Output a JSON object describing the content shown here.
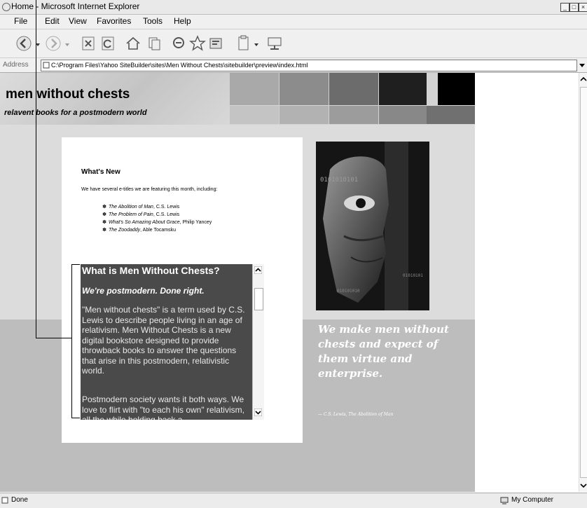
{
  "window": {
    "title": "Home - Microsoft Internet Explorer"
  },
  "menu": {
    "items": [
      "File",
      "Edit",
      "View",
      "Favorites",
      "Tools",
      "Help"
    ]
  },
  "toolbar": {
    "buttons": [
      "back-icon",
      "forward-icon",
      "stop-icon",
      "refresh-icon",
      "home-icon",
      "pages-icon",
      "search-icon",
      "favorites-icon",
      "media-icon",
      "mail-icon",
      "network-icon"
    ]
  },
  "address": {
    "label": "Address",
    "url": "C:\\Program Files\\Yahoo SiteBuilder\\sites\\Men Without Chests\\sitebuilder\\preview\\index.html"
  },
  "site": {
    "title": "men without chests",
    "subtitle": "relavent books for a postmodern world",
    "whats_new": {
      "heading": "What's New",
      "intro": "We have several e-titles we are featuring this month, including:",
      "books": [
        {
          "title": "The Abolition of Man",
          "author": ", C.S. Lewis"
        },
        {
          "title": "The Problem of Pain",
          "author": ", C.S. Lewis"
        },
        {
          "title": "What's So Amazing About Grace",
          "author": ", Philip Yancey"
        },
        {
          "title": "The Zoodaddy",
          "author": ", Able Tocamsku"
        }
      ]
    },
    "about": {
      "title": "What is Men Without Chests?",
      "tagline": "We're postmodern. Done right.",
      "paragraph1": "\"Men without chests\" is a term used by C.S. Lewis to describe people living in an age of relativism. Men Without Chests is a new digital bookstore designed to provide throwback books to answer the questions that arise in this postmodern, relativistic world.",
      "paragraph2": "Postmodern society wants it both ways. We love to flirt with \"to each his own\" relativism, all the while holding back a"
    },
    "quote": {
      "text": "We make men without chests and expect of them virtue and enterprise.",
      "attribution": "— C.S. Lewis, The Abolition of Man"
    },
    "image_text": {
      "code_top": "0101010101",
      "code_mid": "01010101",
      "code_bot": "010101010"
    }
  },
  "status": {
    "text": "Done",
    "zone": "My Computer"
  }
}
